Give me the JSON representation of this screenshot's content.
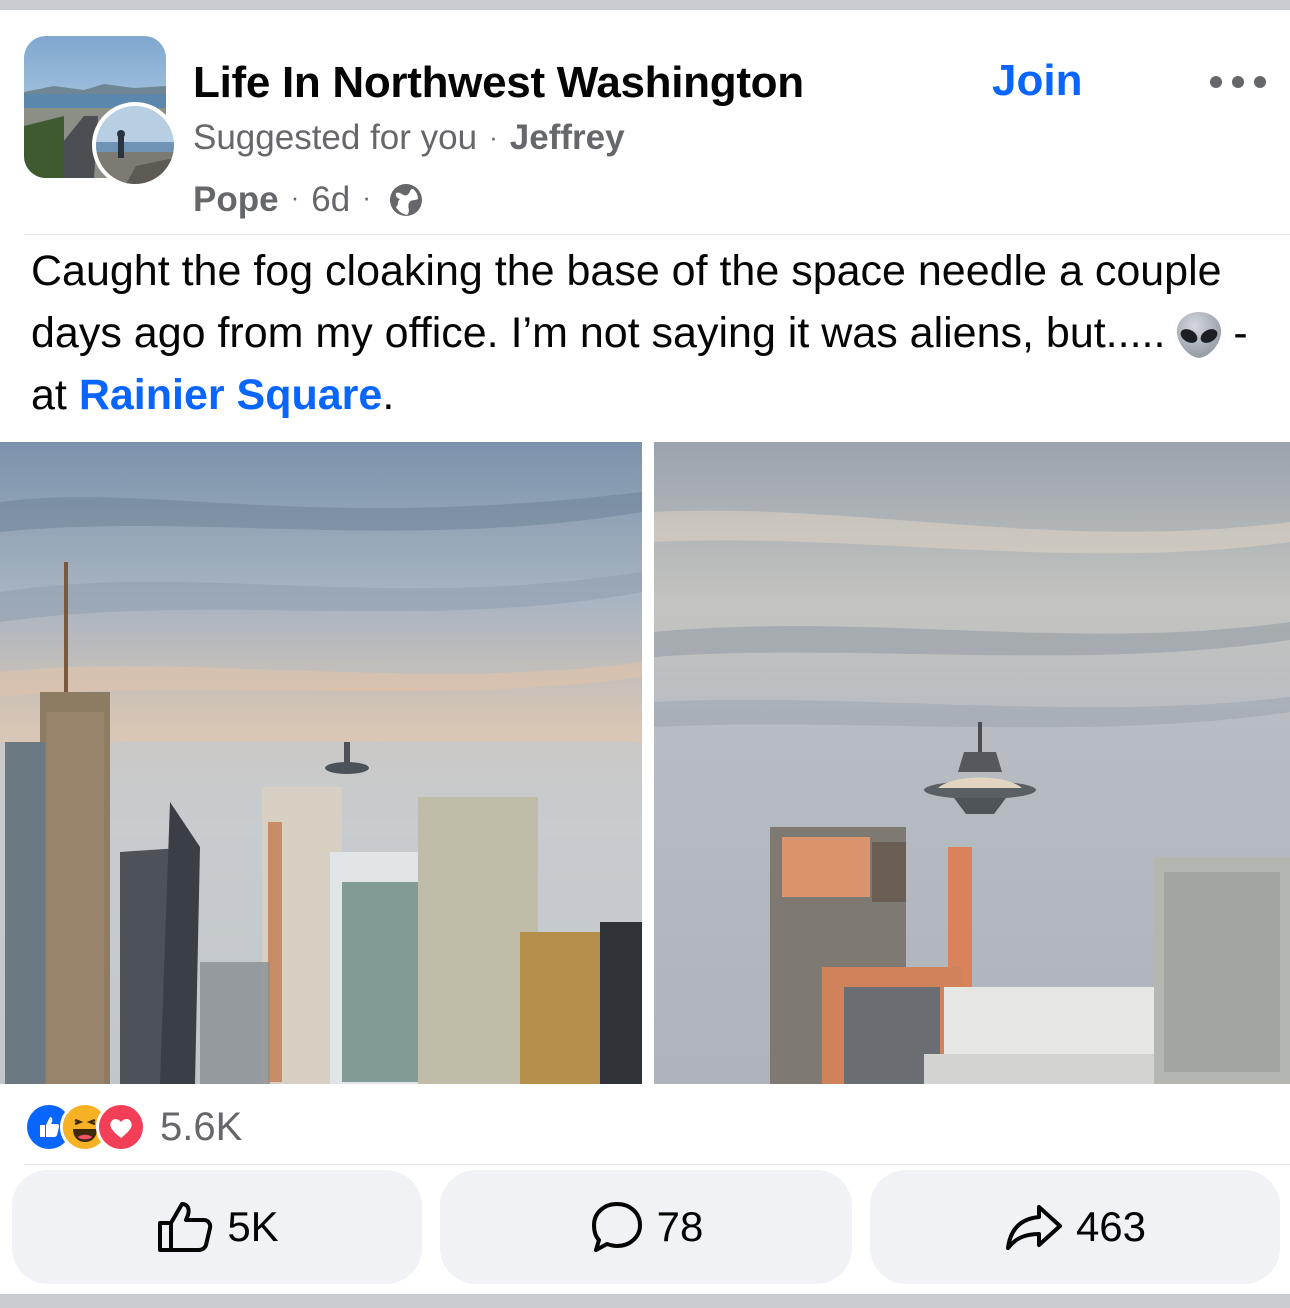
{
  "post": {
    "group_name": "Life In Northwest Washington",
    "suggested_label": "Suggested for you",
    "separator": "·",
    "author_first": "Jeffrey",
    "author_last": "Pope",
    "time_ago": "6d",
    "audience_icon": "globe-icon",
    "join_label": "Join",
    "text_main": "Caught the fog cloaking the base of the space needle a couple days ago from my office. I’m not saying it was aliens, but.....",
    "text_at": "- at",
    "place": "Rainier Square",
    "text_end": ".",
    "emoji": "alien-emoji"
  },
  "reactions": {
    "icons": [
      "like-reaction-icon",
      "haha-reaction-icon",
      "love-reaction-icon"
    ],
    "count": "5.6K"
  },
  "actions": {
    "like_count": "5K",
    "comment_count": "78",
    "share_count": "463"
  },
  "colors": {
    "accent": "#0866ff",
    "secondary_text": "#65676b",
    "button_bg": "#f0f2f5",
    "divider": "#c9ccd1",
    "love": "#f33e58",
    "haha": "#f7b125"
  }
}
